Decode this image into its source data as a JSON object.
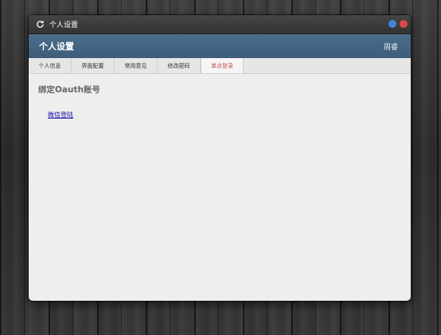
{
  "window": {
    "title": "个人设置",
    "refresh_icon": "refresh-icon",
    "controls": [
      "minimize-button",
      "close-button"
    ],
    "colors": {
      "minimize": "#3f86d4",
      "close": "#d9484b",
      "header": "#456584"
    }
  },
  "header": {
    "title": "个人设置",
    "user": "周睿"
  },
  "tabs": [
    {
      "label": "个人信息"
    },
    {
      "label": "界面配置"
    },
    {
      "label": "常用意见"
    },
    {
      "label": "修改密码"
    },
    {
      "label": "单点登录",
      "active": true
    }
  ],
  "content": {
    "section_title": "绑定Oauth账号",
    "link_label": "微信登陆"
  }
}
